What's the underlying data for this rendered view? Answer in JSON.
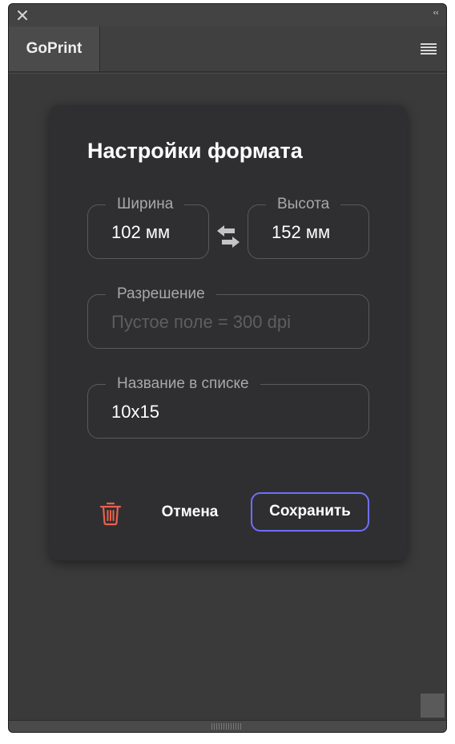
{
  "panel": {
    "tab_label": "GoPrint",
    "collapse_glyph": "‹‹"
  },
  "dialog": {
    "title": "Настройки формата",
    "width": {
      "label": "Ширина",
      "value": "102 мм"
    },
    "height": {
      "label": "Высота",
      "value": "152 мм"
    },
    "resolution": {
      "label": "Разрешение",
      "value": "",
      "placeholder": "Пустое поле = 300 dpi"
    },
    "list_name": {
      "label": "Название в списке",
      "value": "10x15"
    },
    "cancel_label": "Отмена",
    "save_label": "Сохранить"
  },
  "icons": {
    "close": "close-icon",
    "collapse": "double-chevron-left-icon",
    "menu": "hamburger-menu-icon",
    "swap": "swap-arrows-icon",
    "delete": "trash-icon"
  },
  "colors": {
    "panel_bg": "#3a3a3a",
    "card_bg": "#2f2f31",
    "accent": "#6e6fff",
    "danger": "#e8614d",
    "text": "#ffffff",
    "muted": "#a8a8aa"
  }
}
